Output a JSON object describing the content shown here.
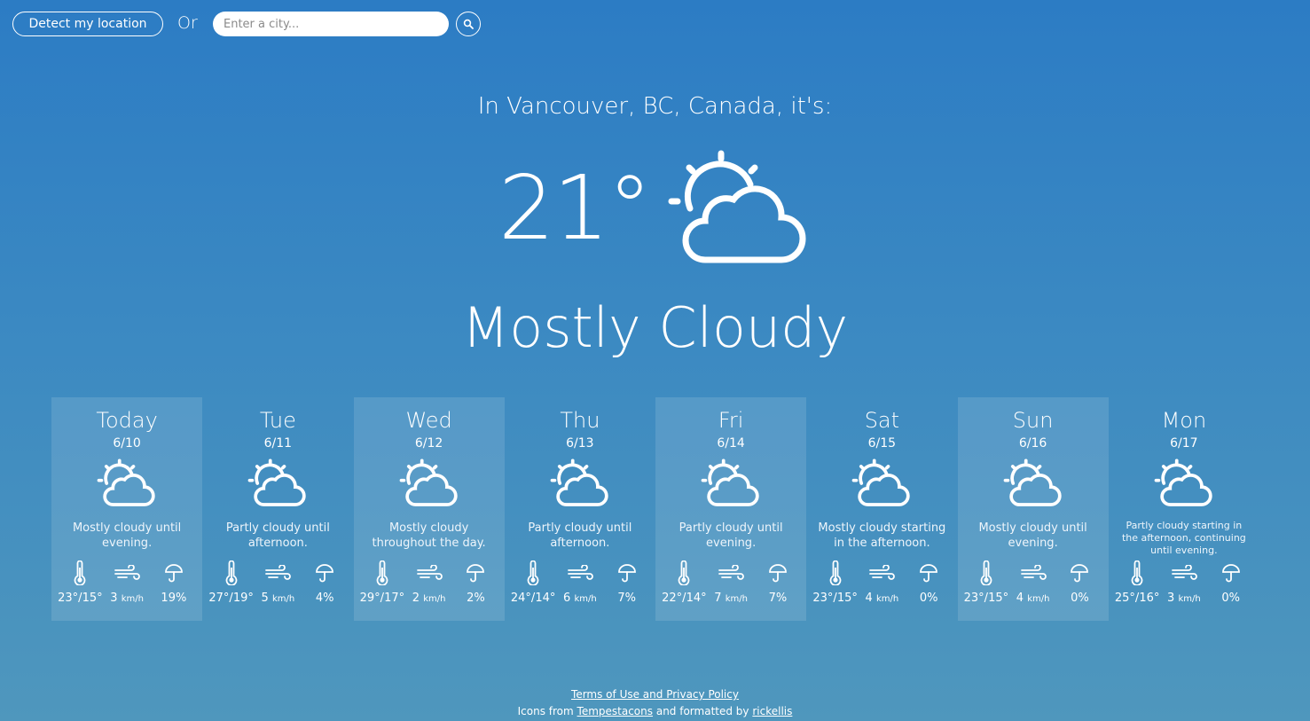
{
  "controls": {
    "detect_label": "Detect my location",
    "or_label": "Or",
    "city_placeholder": "Enter a city...",
    "search_icon": "search-icon"
  },
  "current": {
    "headline": "In Vancouver, BC, Canada, it's:",
    "temperature": "21°",
    "icon": "partly-cloudy-icon",
    "summary": "Mostly Cloudy"
  },
  "forecast": [
    {
      "day": "Today",
      "date": "6/10",
      "summary": "Mostly cloudy until evening.",
      "temp": "23°/15°",
      "wind": "3",
      "wind_unit": "km/h",
      "precip": "19%"
    },
    {
      "day": "Tue",
      "date": "6/11",
      "summary": "Partly cloudy until afternoon.",
      "temp": "27°/19°",
      "wind": "5",
      "wind_unit": "km/h",
      "precip": "4%"
    },
    {
      "day": "Wed",
      "date": "6/12",
      "summary": "Mostly cloudy throughout the day.",
      "temp": "29°/17°",
      "wind": "2",
      "wind_unit": "km/h",
      "precip": "2%"
    },
    {
      "day": "Thu",
      "date": "6/13",
      "summary": "Partly cloudy until afternoon.",
      "temp": "24°/14°",
      "wind": "6",
      "wind_unit": "km/h",
      "precip": "7%"
    },
    {
      "day": "Fri",
      "date": "6/14",
      "summary": "Partly cloudy until evening.",
      "temp": "22°/14°",
      "wind": "7",
      "wind_unit": "km/h",
      "precip": "7%"
    },
    {
      "day": "Sat",
      "date": "6/15",
      "summary": "Mostly cloudy starting in the afternoon.",
      "temp": "23°/15°",
      "wind": "4",
      "wind_unit": "km/h",
      "precip": "0%"
    },
    {
      "day": "Sun",
      "date": "6/16",
      "summary": "Mostly cloudy until evening.",
      "temp": "23°/15°",
      "wind": "4",
      "wind_unit": "km/h",
      "precip": "0%"
    },
    {
      "day": "Mon",
      "date": "6/17",
      "summary": "Partly cloudy starting in the afternoon, continuing until evening.",
      "temp": "25°/16°",
      "wind": "3",
      "wind_unit": "km/h",
      "precip": "0%"
    }
  ],
  "footer": {
    "terms_link": "Terms of Use and Privacy Policy",
    "icons_prefix": "Icons from",
    "icons_link": "Tempestacons",
    "formatted_by": "and formatted by",
    "author_link": "rickellis"
  }
}
